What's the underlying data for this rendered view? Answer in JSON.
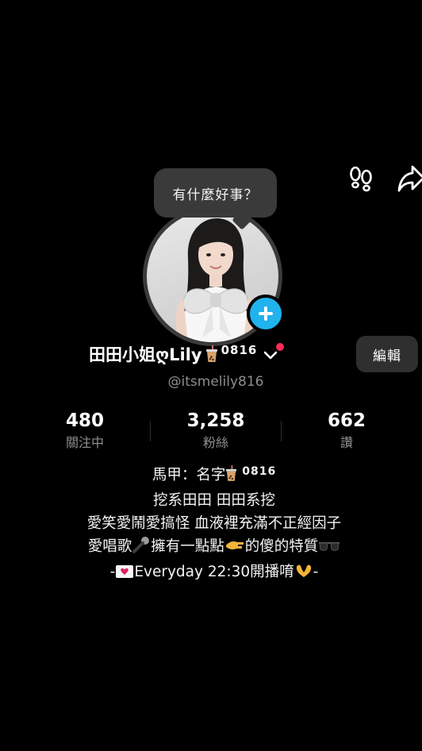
{
  "header": {
    "icons": [
      "footprints-icon",
      "share-icon"
    ]
  },
  "bubble": {
    "text": "有什麼好事？"
  },
  "profile": {
    "display_name": "田田小姐ღLily",
    "name_suffix": "0816",
    "name_icon": "bubble-tea-icon",
    "handle": "@itsmelily816",
    "edit_label": "編輯",
    "accent_color": "#20b3ee",
    "notification_color": "#fe2c55"
  },
  "stats": [
    {
      "value": "480",
      "label": "關注中"
    },
    {
      "value": "3,258",
      "label": "粉絲"
    },
    {
      "value": "662",
      "label": "讚"
    }
  ],
  "bio": {
    "line1_prefix": "馬甲：名字",
    "line1_suffix": "0816",
    "line2": "挖系田田 田田系挖",
    "line3": "愛笑愛鬧愛搞怪 血液裡充滿不正經因子",
    "line4_a": "愛唱歌",
    "line4_b": "擁有一點點",
    "line4_c": "的傻的特質",
    "line5_prefix": "-",
    "line5_text": "Everyday 22:30開播唷",
    "line5_suffix": "-"
  }
}
